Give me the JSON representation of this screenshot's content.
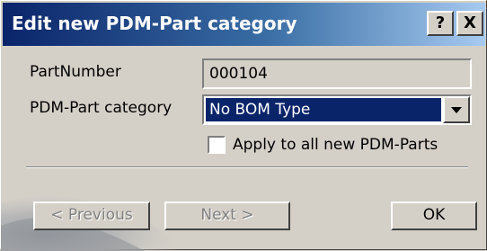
{
  "window": {
    "title": "Edit new PDM-Part category",
    "help_label": "?",
    "close_label": "X"
  },
  "form": {
    "partnumber_label": "PartNumber",
    "partnumber_value": "000104",
    "category_label": "PDM-Part category",
    "category_value": "No BOM Type",
    "apply_all_label": "Apply to all new PDM-Parts",
    "apply_all_checked": false
  },
  "buttons": {
    "previous_label": "< Previous",
    "next_label": "Next >",
    "ok_label": "OK"
  },
  "colors": {
    "titlebar_start": "#0a246a",
    "titlebar_end": "#a6caf0",
    "selection": "#0a246a",
    "dialog_bg": "#d4d0c8"
  }
}
